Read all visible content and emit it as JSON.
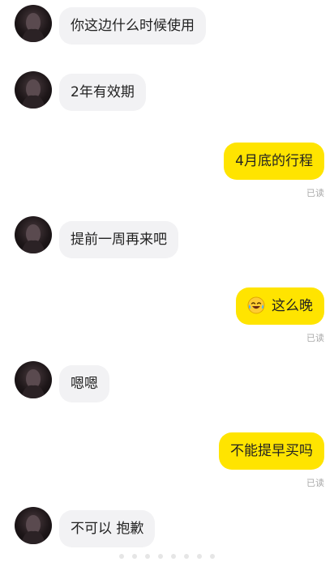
{
  "messages": [
    {
      "side": "in",
      "text": "你这边什么时候使用"
    },
    {
      "side": "in",
      "text": "2年有效期"
    },
    {
      "side": "out",
      "text": "4月底的行程",
      "status": "已读"
    },
    {
      "side": "in",
      "text": "提前一周再来吧"
    },
    {
      "side": "out",
      "text": "这么晚",
      "emoji": "tears-of-joy-emoji",
      "status": "已读"
    },
    {
      "side": "in",
      "text": "嗯嗯"
    },
    {
      "side": "out",
      "text": "不能提早买吗",
      "status": "已读"
    },
    {
      "side": "in",
      "text": "不可以 抱歉"
    }
  ],
  "colors": {
    "outgoing_bubble": "#ffe400",
    "incoming_bubble": "#f2f2f4",
    "read_status": "#a9a9a9"
  }
}
